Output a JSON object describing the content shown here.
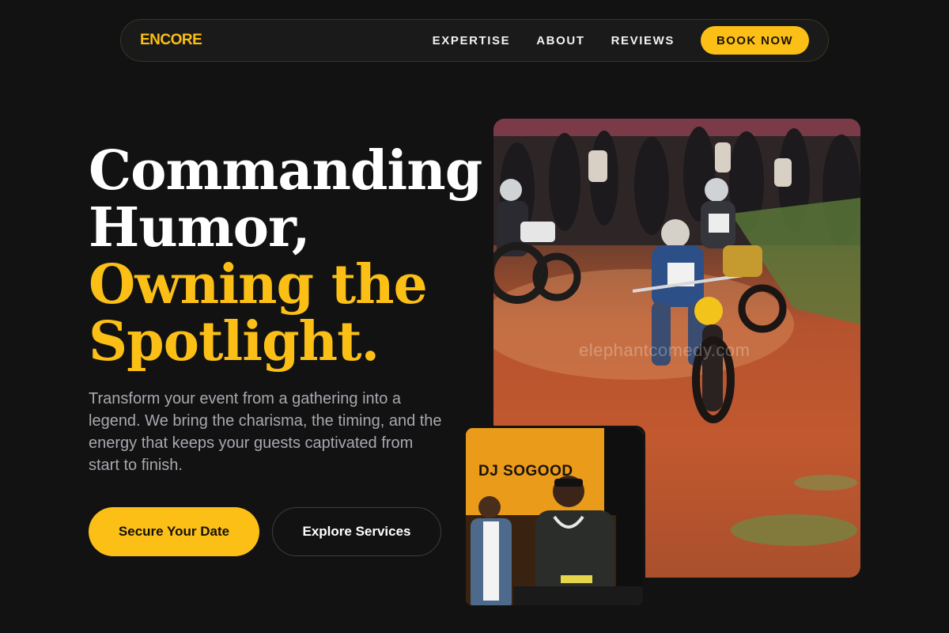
{
  "nav": {
    "logo": "ENCORE",
    "links": [
      "EXPERTISE",
      "ABOUT",
      "REVIEWS"
    ],
    "book_label": "BOOK NOW"
  },
  "hero": {
    "title_line1": "Commanding",
    "title_line2": "Humor,",
    "title_accent1": "Owning the",
    "title_accent2": "Spotlight.",
    "description": "Transform your event from a gathering into a legend. We bring the charisma, the timing, and the energy that keeps your guests captivated from start to finish.",
    "primary_cta": "Secure Your Date",
    "secondary_cta": "Explore Services"
  },
  "images": {
    "main_watermark": "elephantcomedy.com",
    "dj_sign_text": "DJ SOGOOD"
  },
  "colors": {
    "accent": "#fbbf16",
    "background": "#121212",
    "text_muted": "#a7a9b0"
  }
}
